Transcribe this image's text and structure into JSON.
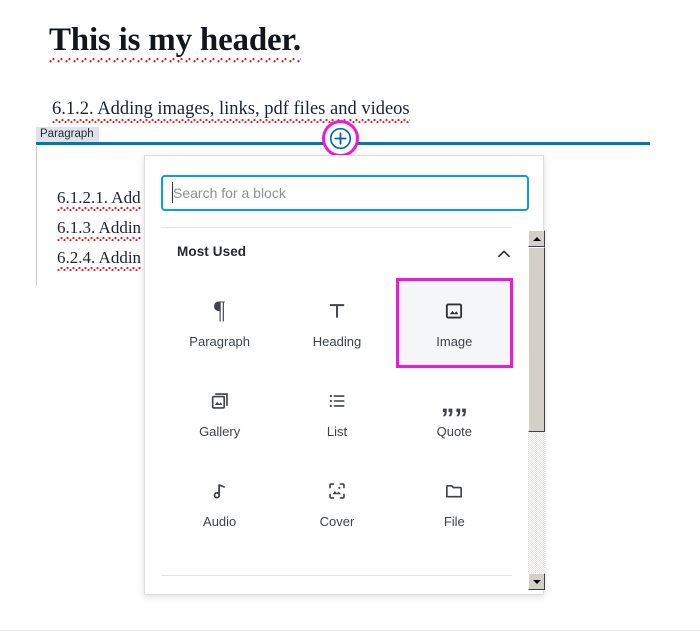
{
  "document": {
    "header": "This is my header.",
    "subheading": "6.1.2. Adding images, links, pdf files and videos",
    "body_lines": [
      "6.1.2.1. Add",
      "6.1.3. Addin",
      "6.2.4. Addin"
    ]
  },
  "editor": {
    "block_tag": "Paragraph",
    "add_block_button": "add-block",
    "accent_blue": "#0079ad",
    "highlight_magenta": "#ef19d8"
  },
  "inserter": {
    "search": {
      "placeholder": "Search for a block",
      "value": ""
    },
    "section": {
      "title": "Most Used",
      "collapse_icon": "chevron-up-icon"
    },
    "blocks": [
      {
        "label": "Paragraph",
        "icon": "paragraph-icon",
        "selected": false
      },
      {
        "label": "Heading",
        "icon": "heading-icon",
        "selected": false
      },
      {
        "label": "Image",
        "icon": "image-icon",
        "selected": true
      },
      {
        "label": "Gallery",
        "icon": "gallery-icon",
        "selected": false
      },
      {
        "label": "List",
        "icon": "list-icon",
        "selected": false
      },
      {
        "label": "Quote",
        "icon": "quote-icon",
        "selected": false
      },
      {
        "label": "Audio",
        "icon": "audio-icon",
        "selected": false
      },
      {
        "label": "Cover",
        "icon": "cover-icon",
        "selected": false
      },
      {
        "label": "File",
        "icon": "file-icon",
        "selected": false
      }
    ]
  },
  "scrollbar": {
    "up_icon": "scroll-up-arrow-icon",
    "down_icon": "scroll-down-arrow-icon"
  }
}
